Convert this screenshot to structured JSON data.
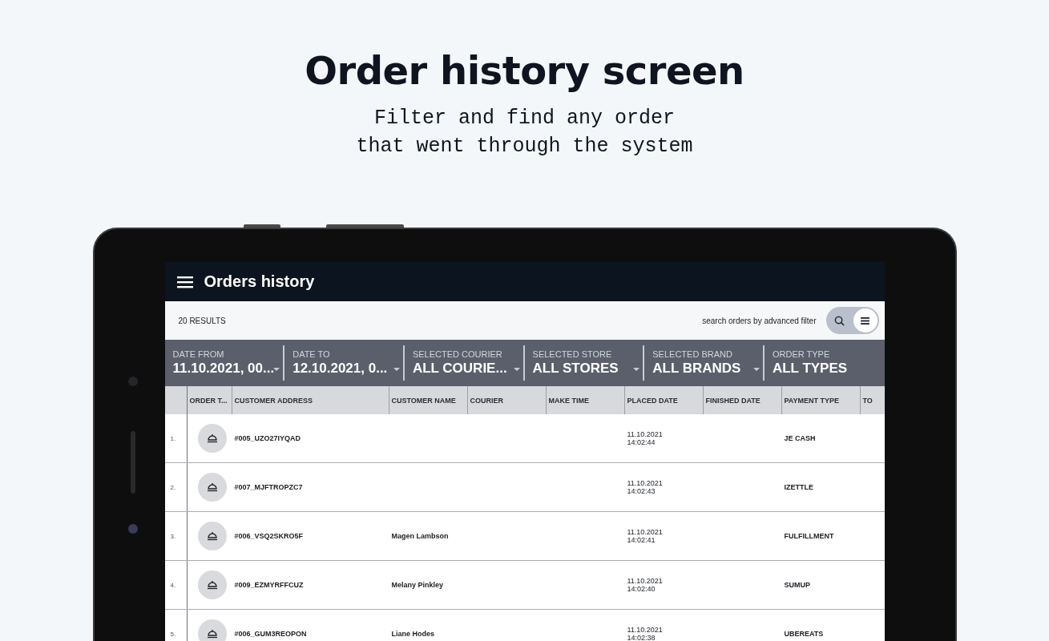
{
  "headline": "Order history screen",
  "subtitle": [
    "Filter and find any order",
    "that went through the system"
  ],
  "app_bar": {
    "title": "Orders history"
  },
  "results_bar": {
    "count": "20 RESULTS",
    "hint": "search orders by advanced filter",
    "view_toggle": [
      {
        "kind": "search",
        "selected": false
      },
      {
        "kind": "list",
        "selected": true
      }
    ]
  },
  "filters": [
    {
      "label": "DATE FROM",
      "value": "11.10.2021, 00..."
    },
    {
      "label": "DATE TO",
      "value": "12.10.2021, 0..."
    },
    {
      "label": "SELECTED COURIER",
      "value": "ALL COURIE..."
    },
    {
      "label": "SELECTED STORE",
      "value": "ALL STORES"
    },
    {
      "label": "SELECTED BRAND",
      "value": "ALL BRANDS"
    },
    {
      "label": "ORDER TYPE",
      "value": "ALL TYPES"
    }
  ],
  "table": {
    "columns": [
      "ORDER T...",
      "CUSTOMER ADDRESS",
      "CUSTOMER NAME",
      "COURIER",
      "MAKE TIME",
      "PLACED DATE",
      "FINISHED DATE",
      "PAYMENT TYPE",
      "TO"
    ],
    "rows": [
      {
        "index": "1.",
        "address": "#005_UZO27IYQAD",
        "placed_date": "11.10.2021",
        "placed_time": "14:02:44",
        "payment": "JE CASH"
      },
      {
        "index": "2.",
        "address": "#007_MJFTROPZC7",
        "placed_date": "11.10.2021",
        "placed_time": "14:02:43",
        "payment": "IZETTLE"
      },
      {
        "index": "3.",
        "address": "#006_VSQ2SKRO5F",
        "name": "Magen Lambson",
        "placed_date": "11.10.2021",
        "placed_time": "14:02:41",
        "payment": "FULFILLMENT"
      },
      {
        "index": "4.",
        "address": "#009_EZMYRFFCUZ",
        "name": "Melany Pinkley",
        "placed_date": "11.10.2021",
        "placed_time": "14:02:40",
        "payment": "SUMUP"
      },
      {
        "index": "5.",
        "address": "#006_GUM3REOPON",
        "name": "Liane Hodes",
        "placed_date": "11.10.2021",
        "placed_time": "14:02:38",
        "payment": "UBEREATS"
      }
    ]
  }
}
